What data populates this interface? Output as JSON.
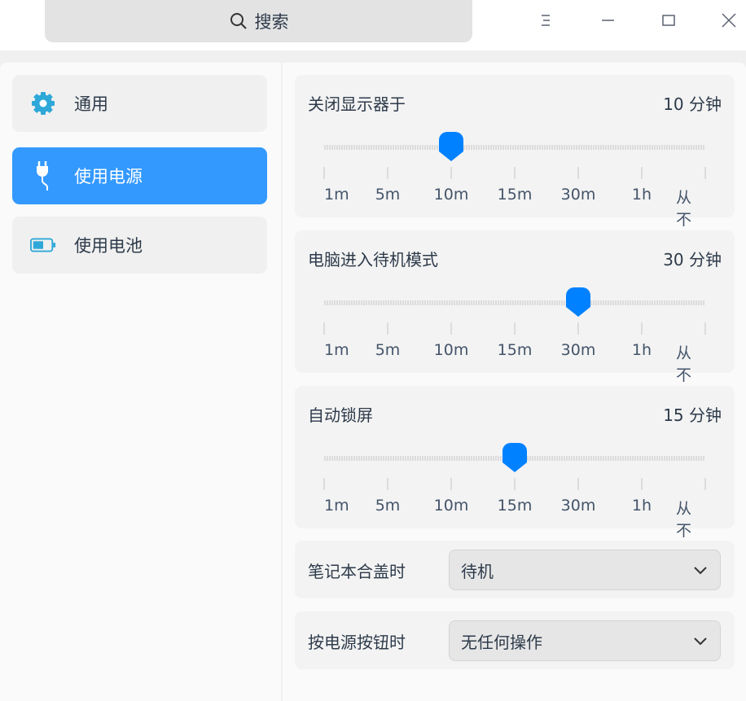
{
  "search": {
    "placeholder": "搜索"
  },
  "window": {
    "menu": "menu",
    "minimize": "minimize",
    "maximize": "maximize",
    "close": "close"
  },
  "sidebar": {
    "items": [
      {
        "label": "通用",
        "icon": "gear-icon"
      },
      {
        "label": "使用电源",
        "icon": "plug-icon",
        "active": true
      },
      {
        "label": "使用电池",
        "icon": "battery-icon"
      }
    ]
  },
  "tick_labels": [
    "1m",
    "5m",
    "10m",
    "15m",
    "30m",
    "1h",
    "从不"
  ],
  "sliders": [
    {
      "title": "关闭显示器于",
      "value": "10 分钟",
      "index": 2
    },
    {
      "title": "电脑进入待机模式",
      "value": "30 分钟",
      "index": 4
    },
    {
      "title": "自动锁屏",
      "value": "15 分钟",
      "index": 3
    }
  ],
  "dropdowns": [
    {
      "label": "笔记本合盖时",
      "value": "待机"
    },
    {
      "label": "按电源按钮时",
      "value": "无任何操作"
    }
  ],
  "colors": {
    "accent": "#3399ff",
    "handle": "#0081ff"
  }
}
